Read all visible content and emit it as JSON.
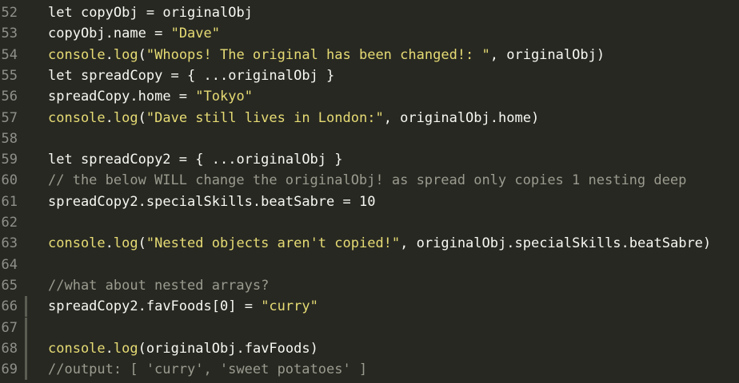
{
  "editor": {
    "lines": [
      {
        "num": "52",
        "tokens": [
          {
            "t": "kw",
            "v": "let "
          },
          {
            "t": "id",
            "v": "copyObj"
          },
          {
            "t": "op",
            "v": " = "
          },
          {
            "t": "id",
            "v": "originalObj"
          }
        ]
      },
      {
        "num": "53",
        "tokens": [
          {
            "t": "id",
            "v": "copyObj"
          },
          {
            "t": "op",
            "v": "."
          },
          {
            "t": "id",
            "v": "name"
          },
          {
            "t": "op",
            "v": " = "
          },
          {
            "t": "str",
            "v": "\"Dave\""
          }
        ]
      },
      {
        "num": "54",
        "tokens": [
          {
            "t": "console",
            "v": "console"
          },
          {
            "t": "op",
            "v": "."
          },
          {
            "t": "method",
            "v": "log"
          },
          {
            "t": "op",
            "v": "("
          },
          {
            "t": "str",
            "v": "\"Whoops! The original has been changed!: \""
          },
          {
            "t": "op",
            "v": ", "
          },
          {
            "t": "id",
            "v": "originalObj"
          },
          {
            "t": "op",
            "v": ")"
          }
        ]
      },
      {
        "num": "55",
        "tokens": [
          {
            "t": "kw",
            "v": "let "
          },
          {
            "t": "id",
            "v": "spreadCopy"
          },
          {
            "t": "op",
            "v": " = { ..."
          },
          {
            "t": "id",
            "v": "originalObj"
          },
          {
            "t": "op",
            "v": " }"
          }
        ]
      },
      {
        "num": "56",
        "tokens": [
          {
            "t": "id",
            "v": "spreadCopy"
          },
          {
            "t": "op",
            "v": "."
          },
          {
            "t": "id",
            "v": "home"
          },
          {
            "t": "op",
            "v": " = "
          },
          {
            "t": "str",
            "v": "\"Tokyo\""
          }
        ]
      },
      {
        "num": "57",
        "tokens": [
          {
            "t": "console",
            "v": "console"
          },
          {
            "t": "op",
            "v": "."
          },
          {
            "t": "method",
            "v": "log"
          },
          {
            "t": "op",
            "v": "("
          },
          {
            "t": "str",
            "v": "\"Dave still lives in London:\""
          },
          {
            "t": "op",
            "v": ", "
          },
          {
            "t": "id",
            "v": "originalObj"
          },
          {
            "t": "op",
            "v": "."
          },
          {
            "t": "id",
            "v": "home"
          },
          {
            "t": "op",
            "v": ")"
          }
        ]
      },
      {
        "num": "58",
        "tokens": []
      },
      {
        "num": "59",
        "tokens": [
          {
            "t": "kw",
            "v": "let "
          },
          {
            "t": "id",
            "v": "spreadCopy2"
          },
          {
            "t": "op",
            "v": " = { ..."
          },
          {
            "t": "id",
            "v": "originalObj"
          },
          {
            "t": "op",
            "v": " }"
          }
        ]
      },
      {
        "num": "60",
        "tokens": [
          {
            "t": "comment",
            "v": "// the below WILL change the originalObj! as spread only copies 1 nesting deep"
          }
        ]
      },
      {
        "num": "61",
        "tokens": [
          {
            "t": "id",
            "v": "spreadCopy2"
          },
          {
            "t": "op",
            "v": "."
          },
          {
            "t": "id",
            "v": "specialSkills"
          },
          {
            "t": "op",
            "v": "."
          },
          {
            "t": "id",
            "v": "beatSabre"
          },
          {
            "t": "op",
            "v": " = "
          },
          {
            "t": "num",
            "v": "10"
          }
        ]
      },
      {
        "num": "62",
        "tokens": []
      },
      {
        "num": "63",
        "tokens": [
          {
            "t": "console",
            "v": "console"
          },
          {
            "t": "op",
            "v": "."
          },
          {
            "t": "method",
            "v": "log"
          },
          {
            "t": "op",
            "v": "("
          },
          {
            "t": "str",
            "v": "\"Nested objects aren't copied!\""
          },
          {
            "t": "op",
            "v": ", "
          },
          {
            "t": "id",
            "v": "originalObj"
          },
          {
            "t": "op",
            "v": "."
          },
          {
            "t": "id",
            "v": "specialSkills"
          },
          {
            "t": "op",
            "v": "."
          },
          {
            "t": "id",
            "v": "beatSabre"
          },
          {
            "t": "op",
            "v": ")"
          }
        ]
      },
      {
        "num": "64",
        "tokens": []
      },
      {
        "num": "65",
        "tokens": [
          {
            "t": "comment",
            "v": "//what about nested arrays?"
          }
        ]
      },
      {
        "num": "66",
        "changed": true,
        "tokens": [
          {
            "t": "id",
            "v": "spreadCopy2"
          },
          {
            "t": "op",
            "v": "."
          },
          {
            "t": "id",
            "v": "favFoods"
          },
          {
            "t": "op",
            "v": "["
          },
          {
            "t": "num",
            "v": "0"
          },
          {
            "t": "op",
            "v": "] = "
          },
          {
            "t": "str",
            "v": "\"curry\""
          }
        ]
      },
      {
        "num": "67",
        "changed": true,
        "tokens": []
      },
      {
        "num": "68",
        "changed": true,
        "tokens": [
          {
            "t": "console",
            "v": "console"
          },
          {
            "t": "op",
            "v": "."
          },
          {
            "t": "method",
            "v": "log"
          },
          {
            "t": "op",
            "v": "("
          },
          {
            "t": "id",
            "v": "originalObj"
          },
          {
            "t": "op",
            "v": "."
          },
          {
            "t": "id",
            "v": "favFoods"
          },
          {
            "t": "op",
            "v": ")"
          }
        ]
      },
      {
        "num": "69",
        "changed": true,
        "tokens": [
          {
            "t": "comment",
            "v": "//output: [ 'curry', 'sweet potatoes' ]"
          }
        ]
      }
    ]
  }
}
